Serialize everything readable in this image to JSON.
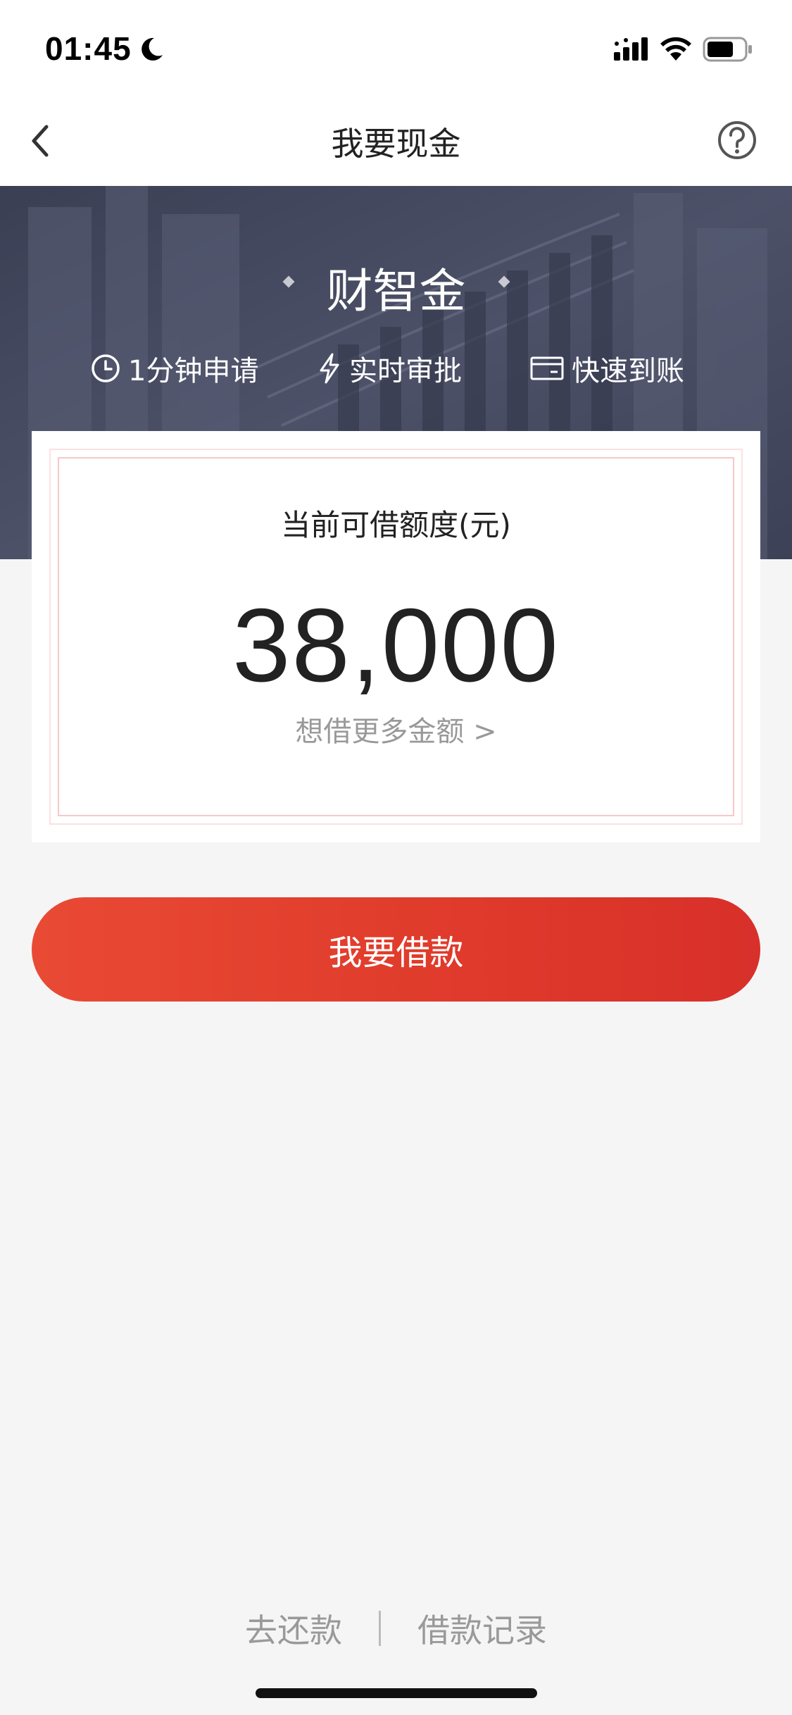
{
  "status": {
    "time": "01:45"
  },
  "nav": {
    "title": "我要现金"
  },
  "hero": {
    "brand": "财智金",
    "features": [
      {
        "icon": "clock-icon",
        "label": "1分钟申请"
      },
      {
        "icon": "lightning-icon",
        "label": "实时审批"
      },
      {
        "icon": "card-icon",
        "label": "快速到账"
      }
    ]
  },
  "card": {
    "label": "当前可借额度(元)",
    "amount": "38,000",
    "more_link": "想借更多金额 >"
  },
  "actions": {
    "borrow": "我要借款"
  },
  "footer": {
    "repay": "去还款",
    "records": "借款记录"
  },
  "colors": {
    "accent": "#e0392b",
    "hero_bg": "#454a60",
    "page_bg": "#f5f5f5"
  }
}
